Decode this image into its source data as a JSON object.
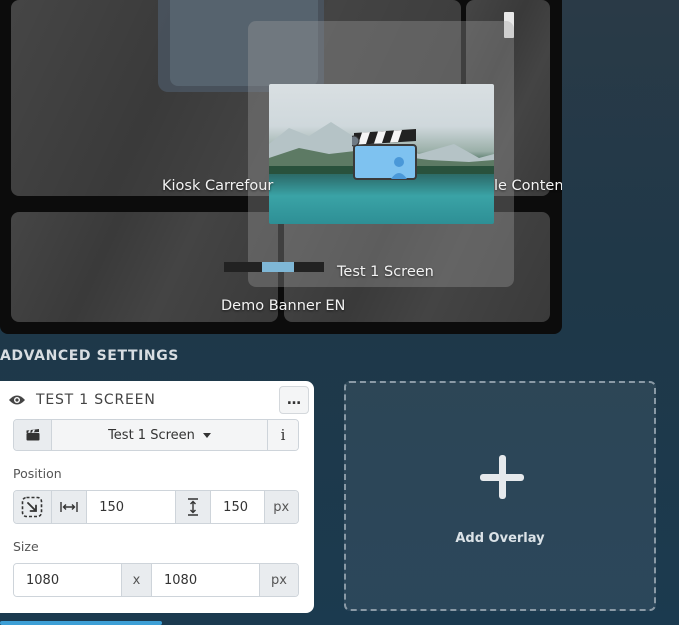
{
  "preview": {
    "panels": [
      {
        "label": "Kiosk Carrefour"
      },
      {
        "label": "le Content"
      },
      {
        "label": "Demo Banner EN"
      },
      {
        "label": "Test 1 Screen"
      }
    ]
  },
  "advanced": {
    "section_title": "ADVANCED SETTINGS",
    "card_title": "TEST 1 SCREEN",
    "more_label": "…",
    "source_selected": "Test 1 Screen",
    "info_label": "i",
    "position_label": "Position",
    "position_x": "150",
    "position_y": "150",
    "position_unit": "px",
    "size_label": "Size",
    "size_w": "1080",
    "size_sep": "x",
    "size_h": "1080",
    "size_unit": "px"
  },
  "overlay": {
    "add_label": "Add Overlay"
  },
  "colors": {
    "accent": "#3d9fd6",
    "card_bg": "#ffffff",
    "page_bg": "#1f3848"
  },
  "icons": [
    "eye-icon",
    "more-icon",
    "clapperboard-icon",
    "caret-down-icon",
    "info-icon",
    "anchor-icon",
    "horizontal-arrows-icon",
    "vertical-arrows-icon",
    "plus-icon"
  ]
}
